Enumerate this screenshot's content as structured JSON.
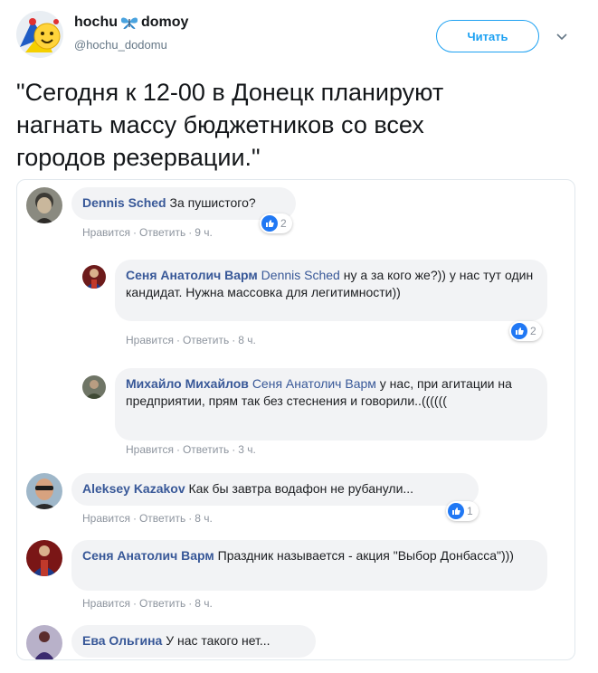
{
  "tweet": {
    "author_name_prefix": "hochu",
    "author_name_suffix": "domoy",
    "author_emoji_icon": "butterfly-icon",
    "handle": "@hochu_dodomu",
    "follow_label": "Читать",
    "text": "\"Сегодня  к 12-00 в Донецк планируют\nнагнать массу бюджетников со всех\nгородов резервации.\""
  },
  "comments": [
    {
      "author": "Dennis Sched",
      "text": "За пушистого?",
      "mention": "",
      "like_label": "Нравится",
      "reply_label": "Ответить",
      "time": "9 ч.",
      "reactions": "2"
    },
    {
      "author": "Сеня Анатолич Варм",
      "mention": "Dennis Sched",
      "text": "ну а за кого же?)) у нас тут один кандидат. Нужна массовка для легитимности))",
      "like_label": "Нравится",
      "reply_label": "Ответить",
      "time": "8 ч.",
      "reactions": "2"
    },
    {
      "author": "Михайло Михайлов",
      "mention": "Сеня Анатолич Варм",
      "text": "у нас, при агитации на предприятии, прям так без стеснения и говорили..((((((",
      "like_label": "Нравится",
      "reply_label": "Ответить",
      "time": "3 ч.",
      "reactions": ""
    },
    {
      "author": "Aleksey Kazakov",
      "mention": "",
      "text": "Как бы завтра водафон не рубанули...",
      "like_label": "Нравится",
      "reply_label": "Ответить",
      "time": "8 ч.",
      "reactions": "1"
    },
    {
      "author": "Сеня Анатолич Варм",
      "mention": "",
      "text": "Праздник называется - акция \"Выбор Донбасса\")))",
      "like_label": "Нравится",
      "reply_label": "Ответить",
      "time": "8 ч.",
      "reactions": ""
    },
    {
      "author": "Ева Ольгина",
      "mention": "",
      "text": "У нас такого нет...",
      "like_label": "",
      "reply_label": "",
      "time": "",
      "reactions": ""
    }
  ],
  "colors": {
    "twitter_blue": "#1da1f2",
    "fb_link": "#385898",
    "fb_like": "#2078f4",
    "bubble_bg": "#f2f3f5"
  }
}
